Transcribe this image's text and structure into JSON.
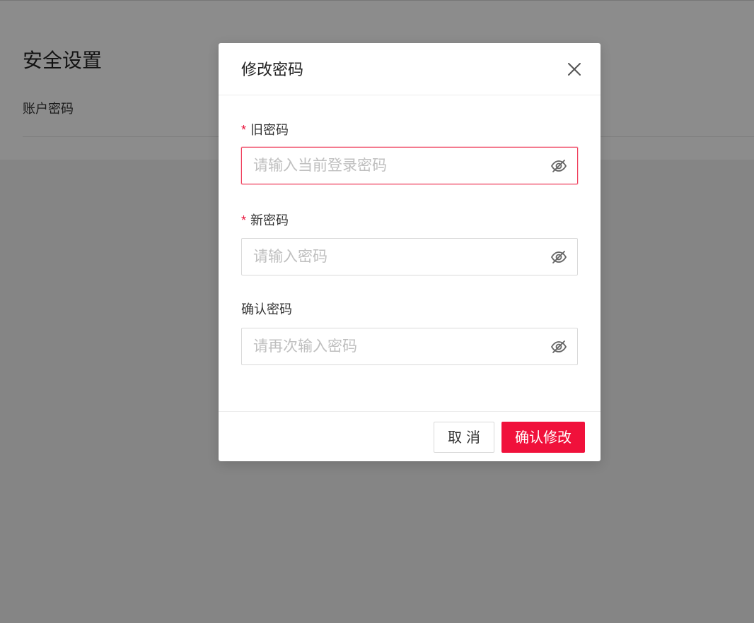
{
  "page": {
    "title": "安全设置",
    "tab_label": "账户密码"
  },
  "dialog": {
    "title": "修改密码",
    "fields": [
      {
        "label": "旧密码",
        "required": true,
        "placeholder": "请输入当前登录密码",
        "value": ""
      },
      {
        "label": "新密码",
        "required": true,
        "placeholder": "请输入密码",
        "value": ""
      },
      {
        "label": "确认密码",
        "required": false,
        "placeholder": "请再次输入密码",
        "value": ""
      }
    ],
    "required_mark": "*",
    "cancel_label": "取消",
    "confirm_label": "确认修改"
  },
  "icons": {
    "close": "close-icon",
    "password_visibility": "eye-off-icon"
  },
  "colors": {
    "accent": "#f0113b",
    "required_mark": "#e8143c",
    "active_input_border": "#ef3d5a"
  }
}
